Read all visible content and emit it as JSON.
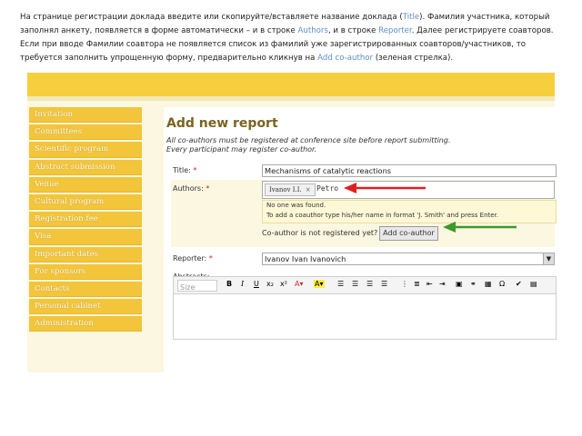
{
  "instruction": {
    "part1": "На странице регистрации доклада введите или скопируйте/вставляете название доклада (",
    "title_word": "Title",
    "part2": "). Фамилия участника, который заполнял анкету, появляется в форме автоматически – и в строке ",
    "authors_word": "Authors",
    "part3": ", и в строке ",
    "reporter_word": "Reporter",
    "part4": ". Далее регистрируете соавторов. Если при вводе Фамилии соавтора не появляется список из фамилий уже зарегистрированных соавторов/участников, то требуется заполнить упрощенную форму, предварительно кликнув на ",
    "addcoauthor_word": "Add co-author",
    "part5": " (зеленая стрелка)."
  },
  "sidebar": {
    "items": [
      {
        "label": "Invitation"
      },
      {
        "label": "Committees"
      },
      {
        "label": "Scientific program"
      },
      {
        "label": "Abstract submission"
      },
      {
        "label": "Venue"
      },
      {
        "label": "Cultural program"
      },
      {
        "label": "Registration fee"
      },
      {
        "label": "Visa"
      },
      {
        "label": "Important dates"
      },
      {
        "label": "For sponsors"
      },
      {
        "label": "Contacts"
      },
      {
        "label": "Personal cabinet"
      },
      {
        "label": "Administration"
      }
    ]
  },
  "form": {
    "heading": "Add new report",
    "note_line1": "All co-authors must be registered at conference site before report submitting.",
    "note_line2": "Every participant may register co-author.",
    "title_label": "Title:",
    "required_mark": "*",
    "title_value": "Mechanisms of catalytic reactions",
    "authors_label": "Authors:",
    "author_tag": "Ivanov I.I.",
    "tag_remove": "×",
    "authors_input_value": "Petro",
    "hint_line1": "No one was found.",
    "hint_line2": "To add a coauthor type his/her name in format 'J. Smith' and press Enter.",
    "coauthor_question": "Co-author is not registered yet?",
    "add_coauthor_label": "Add co-author",
    "reporter_label": "Reporter:",
    "reporter_value": "Ivanov Ivan Ivanovich",
    "abstracts_label": "Abstracts:",
    "editor_size_placeholder": "Size"
  },
  "colors": {
    "top_bar": "#f6cf3f",
    "sidebar_item": "#f2c53a",
    "red_arrow": "#e02020",
    "green_arrow": "#3a9a2a",
    "heading": "#7a6420"
  }
}
